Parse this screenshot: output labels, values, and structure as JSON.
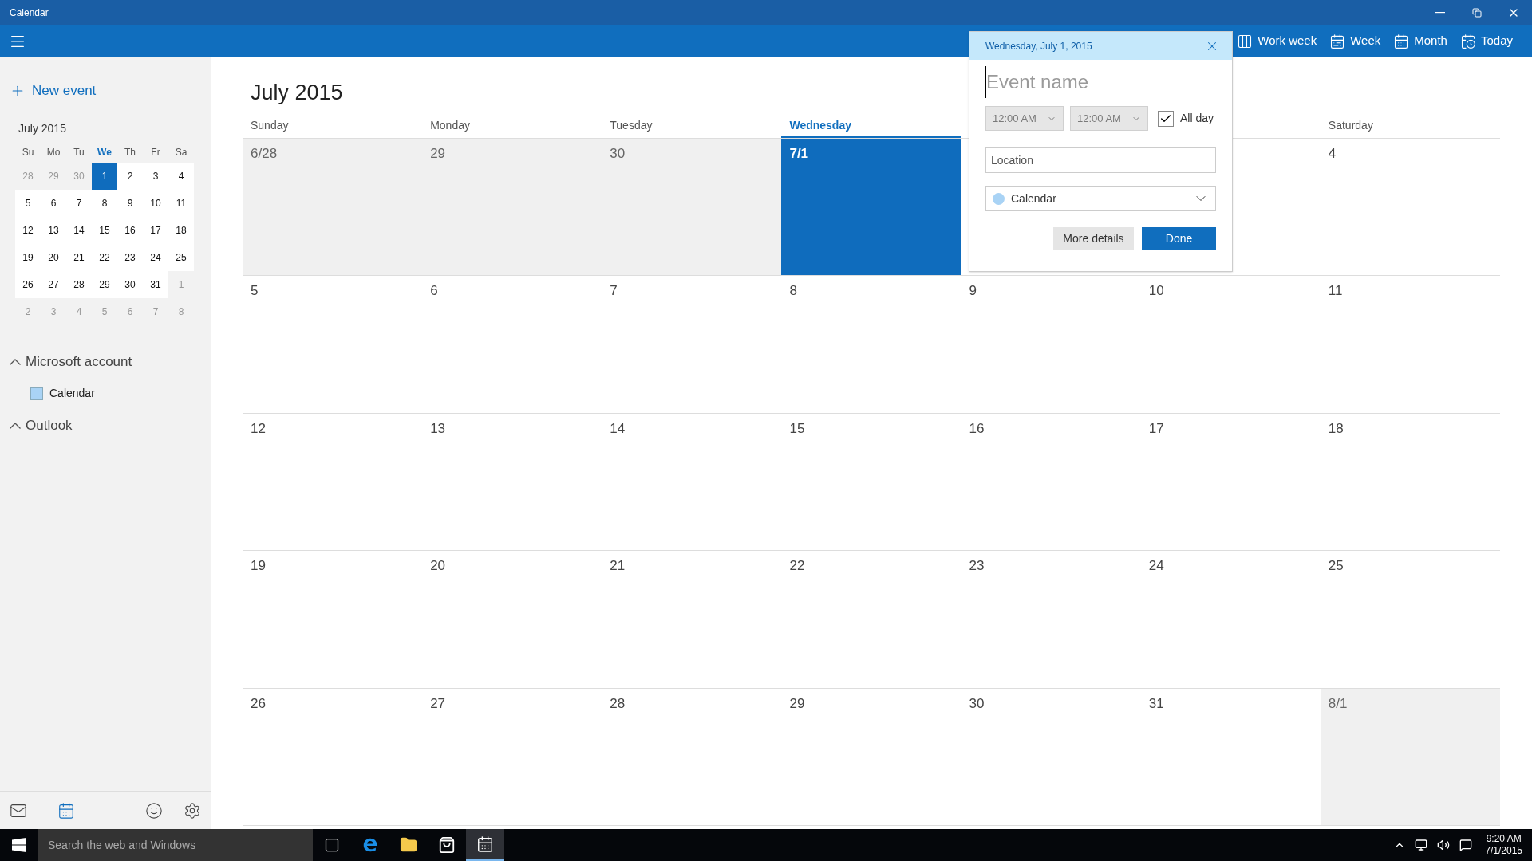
{
  "window": {
    "title": "Calendar"
  },
  "toolbar": {
    "buttons": [
      {
        "label": "Work week",
        "kind": "workweek"
      },
      {
        "label": "Week",
        "kind": "week"
      },
      {
        "label": "Month",
        "kind": "month"
      },
      {
        "label": "Today",
        "kind": "today"
      }
    ]
  },
  "sidebar": {
    "new_event": "New event",
    "mini_calendar": {
      "title": "July 2015",
      "weekdays": [
        {
          "label": "Su",
          "selected": false
        },
        {
          "label": "Mo",
          "selected": false
        },
        {
          "label": "Tu",
          "selected": false
        },
        {
          "label": "We",
          "selected": true
        },
        {
          "label": "Th",
          "selected": false
        },
        {
          "label": "Fr",
          "selected": false
        },
        {
          "label": "Sa",
          "selected": false
        }
      ],
      "weeks": [
        [
          {
            "day": "28",
            "in_month": false,
            "selected": false
          },
          {
            "day": "29",
            "in_month": false,
            "selected": false
          },
          {
            "day": "30",
            "in_month": false,
            "selected": false
          },
          {
            "day": "1",
            "in_month": true,
            "selected": true
          },
          {
            "day": "2",
            "in_month": true,
            "selected": false
          },
          {
            "day": "3",
            "in_month": true,
            "selected": false
          },
          {
            "day": "4",
            "in_month": true,
            "selected": false
          }
        ],
        [
          {
            "day": "5",
            "in_month": true,
            "selected": false
          },
          {
            "day": "6",
            "in_month": true,
            "selected": false
          },
          {
            "day": "7",
            "in_month": true,
            "selected": false
          },
          {
            "day": "8",
            "in_month": true,
            "selected": false
          },
          {
            "day": "9",
            "in_month": true,
            "selected": false
          },
          {
            "day": "10",
            "in_month": true,
            "selected": false
          },
          {
            "day": "11",
            "in_month": true,
            "selected": false
          }
        ],
        [
          {
            "day": "12",
            "in_month": true,
            "selected": false
          },
          {
            "day": "13",
            "in_month": true,
            "selected": false
          },
          {
            "day": "14",
            "in_month": true,
            "selected": false
          },
          {
            "day": "15",
            "in_month": true,
            "selected": false
          },
          {
            "day": "16",
            "in_month": true,
            "selected": false
          },
          {
            "day": "17",
            "in_month": true,
            "selected": false
          },
          {
            "day": "18",
            "in_month": true,
            "selected": false
          }
        ],
        [
          {
            "day": "19",
            "in_month": true,
            "selected": false
          },
          {
            "day": "20",
            "in_month": true,
            "selected": false
          },
          {
            "day": "21",
            "in_month": true,
            "selected": false
          },
          {
            "day": "22",
            "in_month": true,
            "selected": false
          },
          {
            "day": "23",
            "in_month": true,
            "selected": false
          },
          {
            "day": "24",
            "in_month": true,
            "selected": false
          },
          {
            "day": "25",
            "in_month": true,
            "selected": false
          }
        ],
        [
          {
            "day": "26",
            "in_month": true,
            "selected": false
          },
          {
            "day": "27",
            "in_month": true,
            "selected": false
          },
          {
            "day": "28",
            "in_month": true,
            "selected": false
          },
          {
            "day": "29",
            "in_month": true,
            "selected": false
          },
          {
            "day": "30",
            "in_month": true,
            "selected": false
          },
          {
            "day": "31",
            "in_month": true,
            "selected": false
          },
          {
            "day": "1",
            "in_month": false,
            "selected": false
          }
        ],
        [
          {
            "day": "2",
            "in_month": false,
            "selected": false
          },
          {
            "day": "3",
            "in_month": false,
            "selected": false
          },
          {
            "day": "4",
            "in_month": false,
            "selected": false
          },
          {
            "day": "5",
            "in_month": false,
            "selected": false
          },
          {
            "day": "6",
            "in_month": false,
            "selected": false
          },
          {
            "day": "7",
            "in_month": false,
            "selected": false
          },
          {
            "day": "8",
            "in_month": false,
            "selected": false
          }
        ]
      ]
    },
    "accounts": [
      {
        "name": "Microsoft account",
        "expanded": true,
        "calendars": [
          {
            "name": "Calendar",
            "color": "#a9d3f5"
          }
        ]
      },
      {
        "name": "Outlook",
        "expanded": true
      }
    ]
  },
  "month": {
    "title": "July 2015",
    "weekdays": [
      {
        "label": "Sunday",
        "selected": false
      },
      {
        "label": "Monday",
        "selected": false
      },
      {
        "label": "Tuesday",
        "selected": false
      },
      {
        "label": "Wednesday",
        "selected": true
      },
      {
        "selected": false
      },
      {
        "selected": false
      },
      {
        "label": "Saturday",
        "selected": false
      }
    ],
    "weeks": [
      [
        {
          "label": "6/28",
          "in_month": false,
          "selected": false
        },
        {
          "label": "29",
          "in_month": false,
          "selected": false
        },
        {
          "label": "30",
          "in_month": false,
          "selected": false
        },
        {
          "label": "7/1",
          "in_month": true,
          "selected": true
        },
        {
          "in_month": true,
          "selected": false
        },
        {
          "in_month": true,
          "selected": false
        },
        {
          "label": "4",
          "in_month": true,
          "selected": false
        }
      ],
      [
        {
          "label": "5",
          "in_month": true,
          "selected": false
        },
        {
          "label": "6",
          "in_month": true,
          "selected": false
        },
        {
          "label": "7",
          "in_month": true,
          "selected": false
        },
        {
          "label": "8",
          "in_month": true,
          "selected": false
        },
        {
          "label": "9",
          "in_month": true,
          "selected": false
        },
        {
          "label": "10",
          "in_month": true,
          "selected": false
        },
        {
          "label": "11",
          "in_month": true,
          "selected": false
        }
      ],
      [
        {
          "label": "12",
          "in_month": true,
          "selected": false
        },
        {
          "label": "13",
          "in_month": true,
          "selected": false
        },
        {
          "label": "14",
          "in_month": true,
          "selected": false
        },
        {
          "label": "15",
          "in_month": true,
          "selected": false
        },
        {
          "label": "16",
          "in_month": true,
          "selected": false
        },
        {
          "label": "17",
          "in_month": true,
          "selected": false
        },
        {
          "label": "18",
          "in_month": true,
          "selected": false
        }
      ],
      [
        {
          "label": "19",
          "in_month": true,
          "selected": false
        },
        {
          "label": "20",
          "in_month": true,
          "selected": false
        },
        {
          "label": "21",
          "in_month": true,
          "selected": false
        },
        {
          "label": "22",
          "in_month": true,
          "selected": false
        },
        {
          "label": "23",
          "in_month": true,
          "selected": false
        },
        {
          "label": "24",
          "in_month": true,
          "selected": false
        },
        {
          "label": "25",
          "in_month": true,
          "selected": false
        }
      ],
      [
        {
          "label": "26",
          "in_month": true,
          "selected": false
        },
        {
          "label": "27",
          "in_month": true,
          "selected": false
        },
        {
          "label": "28",
          "in_month": true,
          "selected": false
        },
        {
          "label": "29",
          "in_month": true,
          "selected": false
        },
        {
          "label": "30",
          "in_month": true,
          "selected": false
        },
        {
          "label": "31",
          "in_month": true,
          "selected": false
        },
        {
          "label": "8/1",
          "in_month": false,
          "selected": false
        }
      ]
    ]
  },
  "popup": {
    "date": "Wednesday, July 1, 2015",
    "event_name_placeholder": "Event name",
    "start_time": {
      "value": "12:00 AM",
      "disabled": true
    },
    "end_time": {
      "value": "12:00 AM",
      "disabled": true
    },
    "all_day": {
      "label": "All day",
      "checked": true
    },
    "location_placeholder": "Location",
    "calendar": {
      "label": "Calendar",
      "color": "#a9d3f5"
    },
    "buttons": [
      {
        "label": "More details",
        "kind": "secondary"
      },
      {
        "label": "Done",
        "kind": "primary"
      }
    ]
  },
  "taskbar": {
    "search_placeholder": "Search the web and Windows",
    "apps": [
      {
        "kind": "task-view",
        "selected": false
      },
      {
        "kind": "browser",
        "selected": false
      },
      {
        "kind": "files",
        "selected": false
      },
      {
        "kind": "store",
        "selected": false
      },
      {
        "kind": "calendar",
        "selected": true
      }
    ],
    "clock": {
      "time": "9:20 AM",
      "date": "7/1/2015"
    }
  }
}
